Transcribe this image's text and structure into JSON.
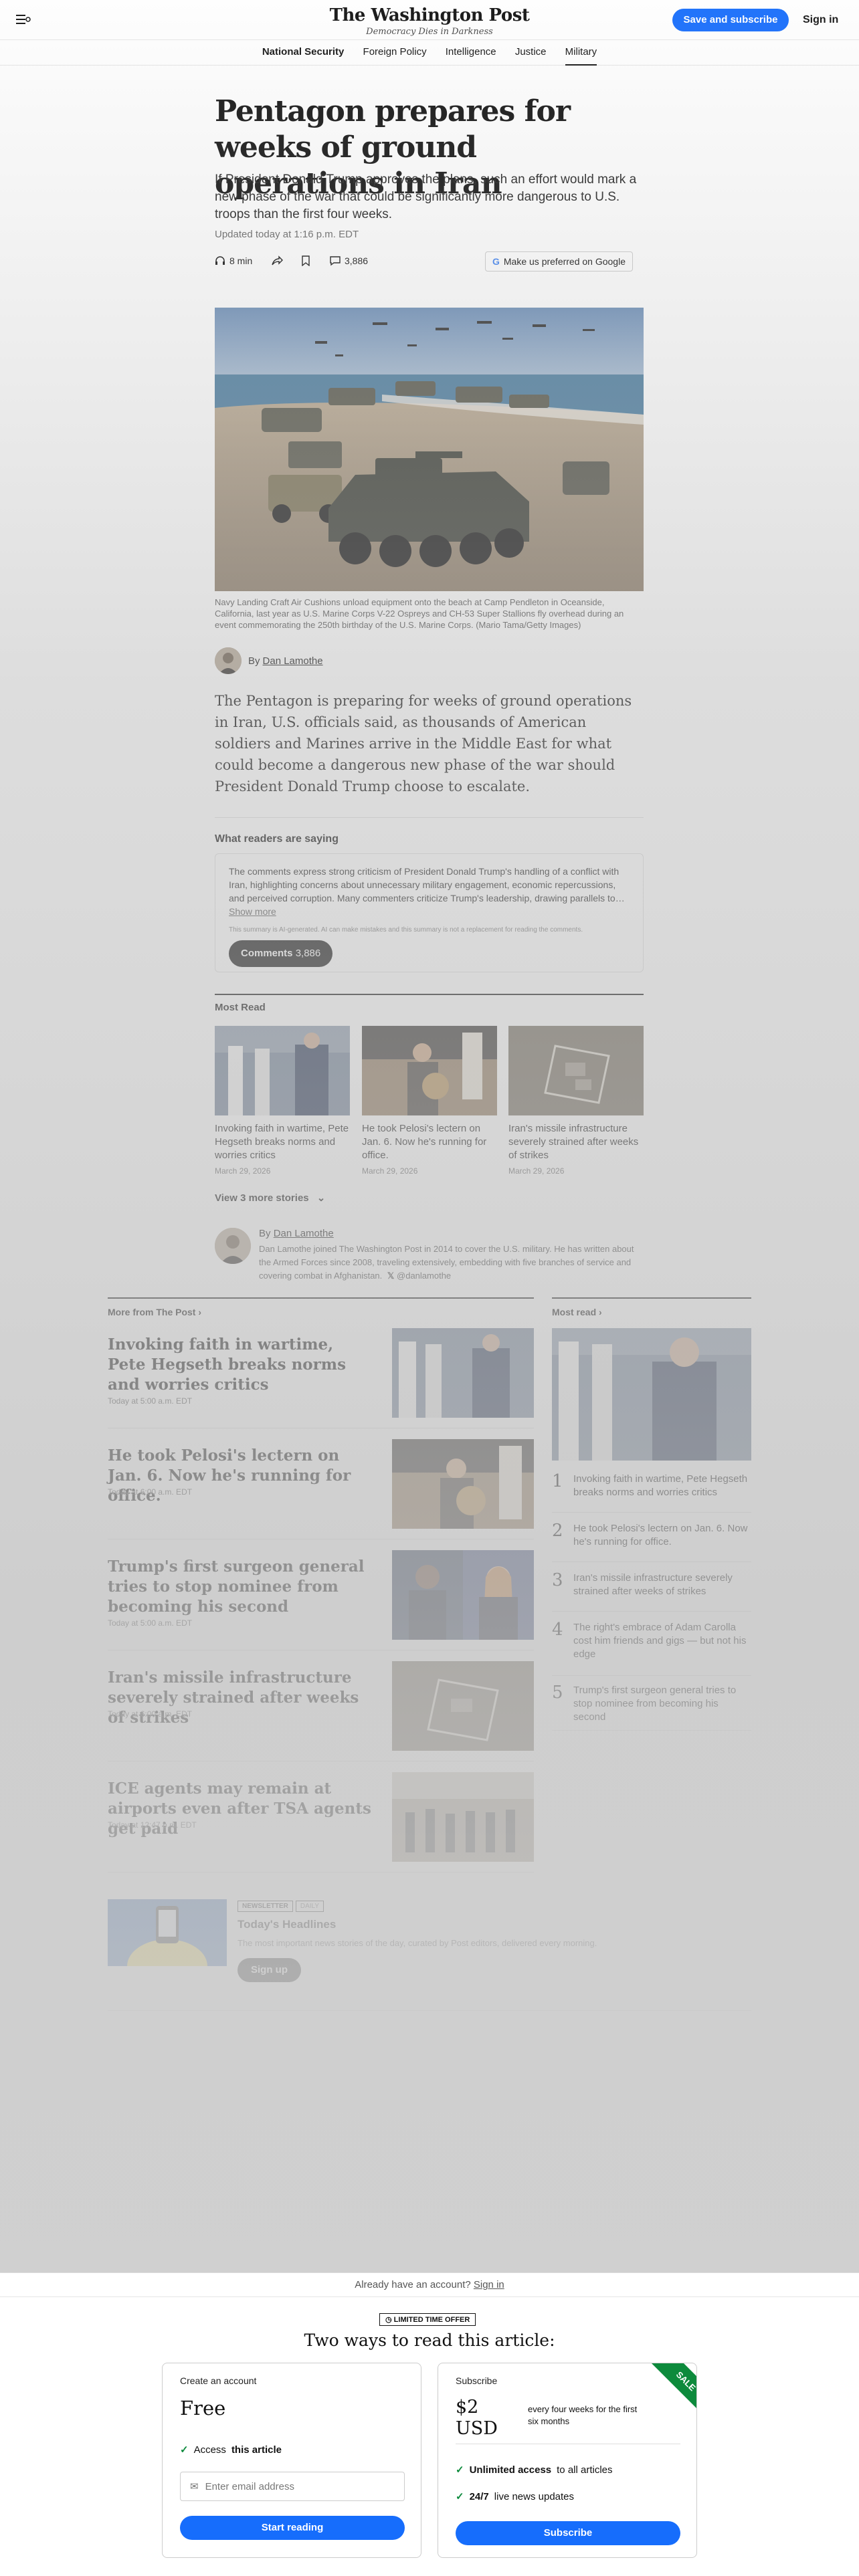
{
  "header": {
    "logo": "The Washington Post",
    "tagline": "Democracy Dies in Darkness",
    "subscribe_label": "Save and subscribe",
    "signin_label": "Sign in"
  },
  "nav": {
    "items": [
      "National Security",
      "Foreign Policy",
      "Intelligence",
      "Justice",
      "Military"
    ],
    "active": "Military"
  },
  "article": {
    "headline": "Pentagon prepares for weeks of ground operations in Iran",
    "dek": "If President Donald Trump approves the plans, such an effort would mark a new phase of the war that could be significantly more dangerous to U.S. troops than the first four weeks.",
    "updated": "Updated today at 1:16 p.m. EDT",
    "listen": "8 min",
    "comment_count": "3,886",
    "prefer_label": "Make us preferred on Google",
    "caption": "Navy Landing Craft Air Cushions unload equipment onto the beach at Camp Pendleton in Oceanside, California, last year as U.S. Marine Corps V-22 Ospreys and CH-53 Super Stallions fly overhead during an event commemorating the 250th birthday of the U.S. Marine Corps. (Mario Tama/Getty Images)",
    "by_prefix": "By",
    "author": "Dan Lamothe",
    "lead": "The Pentagon is preparing for weeks of ground operations in Iran, U.S. officials said, as thousands of American soldiers and Marines arrive in the Middle East for what could become a dangerous new phase of the war should President Donald Trump choose to escalate."
  },
  "readers": {
    "heading": "What readers are saying",
    "summary": "The comments express strong criticism of President Donald Trump's handling of a conflict with Iran, highlighting concerns about unnecessary military engagement, economic repercussions, and perceived corruption. Many commenters criticize Trump's leadership, drawing parallels to…",
    "show_more": "Show more",
    "disclaimer": "This summary is AI-generated. AI can make mistakes and this summary is not a replacement for reading the comments.",
    "comments_label": "Comments",
    "comments_count": "3,886"
  },
  "most_read_inline": {
    "heading": "Most Read",
    "items": [
      {
        "title": "Invoking faith in wartime, Pete Hegseth breaks norms and worries critics",
        "date": "March 29, 2026"
      },
      {
        "title": "He took Pelosi's lectern on Jan. 6. Now he's running for office.",
        "date": "March 29, 2026"
      },
      {
        "title": "Iran's missile infrastructure severely strained after weeks of strikes",
        "date": "March 29, 2026"
      }
    ],
    "view_more": "View 3 more stories"
  },
  "bio": {
    "by_prefix": "By",
    "author": "Dan Lamothe",
    "text": "Dan Lamothe joined The Washington Post in 2014 to cover the U.S. military. He has written about the Armed Forces since 2008, traveling extensively, embedding with five branches of service and covering combat in Afghanistan.",
    "handle": "@danlamothe"
  },
  "more_from": {
    "heading": "More from The Post",
    "stories": [
      {
        "title": "Invoking faith in wartime, Pete Hegseth breaks norms and worries critics",
        "time": "Today at 5:00 a.m. EDT"
      },
      {
        "title": "He took Pelosi's lectern on Jan. 6. Now he's running for office.",
        "time": "Today at 6:00 a.m. EDT"
      },
      {
        "title": "Trump's first surgeon general tries to stop nominee from becoming his second",
        "time": "Today at 5:00 a.m. EDT"
      },
      {
        "title": "Iran's missile infrastructure severely strained after weeks of strikes",
        "time": "Today at 6:00 a.m. EDT"
      },
      {
        "title": "ICE agents may remain at airports even after TSA agents get paid",
        "time": "Today at 12:47 p.m. EDT"
      }
    ]
  },
  "most_read_side": {
    "heading": "Most read",
    "items": [
      {
        "num": "1",
        "title": "Invoking faith in wartime, Pete Hegseth breaks norms and worries critics"
      },
      {
        "num": "2",
        "title": "He took Pelosi's lectern on Jan. 6. Now he's running for office."
      },
      {
        "num": "3",
        "title": "Iran's missile infrastructure severely strained after weeks of strikes"
      },
      {
        "num": "4",
        "title": "The right's embrace of Adam Carolla cost him friends and gigs — but not his edge"
      },
      {
        "num": "5",
        "title": "Trump's first surgeon general tries to stop nominee from becoming his second"
      }
    ]
  },
  "newsletter": {
    "tag1": "NEWSLETTER",
    "tag2": "DAILY",
    "title": "Today's Headlines",
    "desc": "The most important news stories of the day, curated by Post editors, delivered every morning.",
    "cta": "Sign up"
  },
  "paywall": {
    "account_prompt": "Already have an account?",
    "signin": "Sign in",
    "offer": "LIMITED TIME OFFER",
    "title": "Two ways to read this article:",
    "free_card": {
      "label": "Create an account",
      "price": "Free",
      "benefit_prefix": "Access",
      "benefit_bold": "this article",
      "email_placeholder": "Enter email address",
      "cta": "Start reading"
    },
    "sub_card": {
      "label": "Subscribe",
      "price": "$2 USD",
      "per": "every four weeks for the first six months",
      "benefit1_bold": "Unlimited access",
      "benefit1_rest": "to all articles",
      "benefit2_bold": "24/7",
      "benefit2_rest": "live news updates",
      "cta": "Subscribe",
      "sale": "SALE"
    }
  },
  "colors": {
    "accent": "#166dfc",
    "sale": "#0d8a3c"
  }
}
